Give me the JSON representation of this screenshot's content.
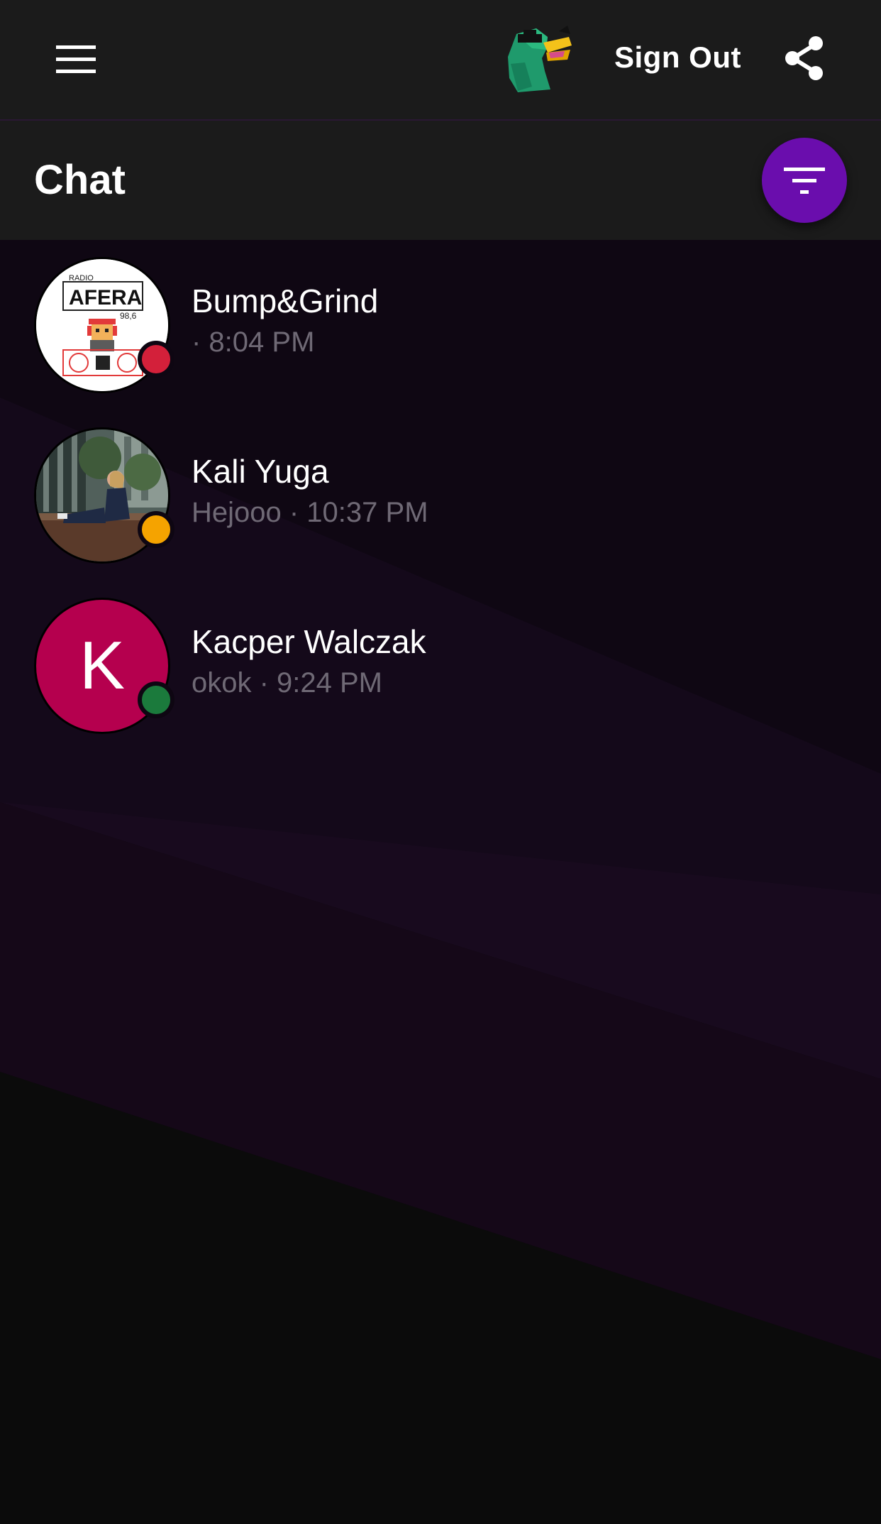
{
  "app": {
    "sign_out_label": "Sign Out"
  },
  "page": {
    "title": "Chat"
  },
  "chats": [
    {
      "name": "Bump&Grind",
      "preview": "",
      "time": "8:04 PM",
      "meta": "· 8:04 PM",
      "avatar_type": "image-logo",
      "avatar_text_top": "RADIO",
      "avatar_text_main": "AFERA",
      "avatar_text_freq": "98,6",
      "status": "busy",
      "status_color": "#d3203a"
    },
    {
      "name": "Kali Yuga",
      "preview": "Hejooo",
      "time": "10:37 PM",
      "meta": "Hejooo · 10:37 PM",
      "avatar_type": "image-photo",
      "status": "away",
      "status_color": "#f5a300"
    },
    {
      "name": "Kacper Walczak",
      "preview": "okok",
      "time": "9:24 PM",
      "meta": "okok · 9:24 PM",
      "avatar_type": "initial",
      "avatar_initial": "K",
      "avatar_color": "#b5004e",
      "status": "online",
      "status_color": "#1b7a3c"
    }
  ],
  "icons": {
    "menu": "hamburger-menu-icon",
    "share": "share-icon",
    "filter": "filter-icon",
    "logo": "duck-logo-icon"
  },
  "colors": {
    "topbar_bg": "#1b1b1b",
    "accent": "#6a0dad",
    "list_bg": "#130818",
    "muted_text": "#6f6975"
  }
}
